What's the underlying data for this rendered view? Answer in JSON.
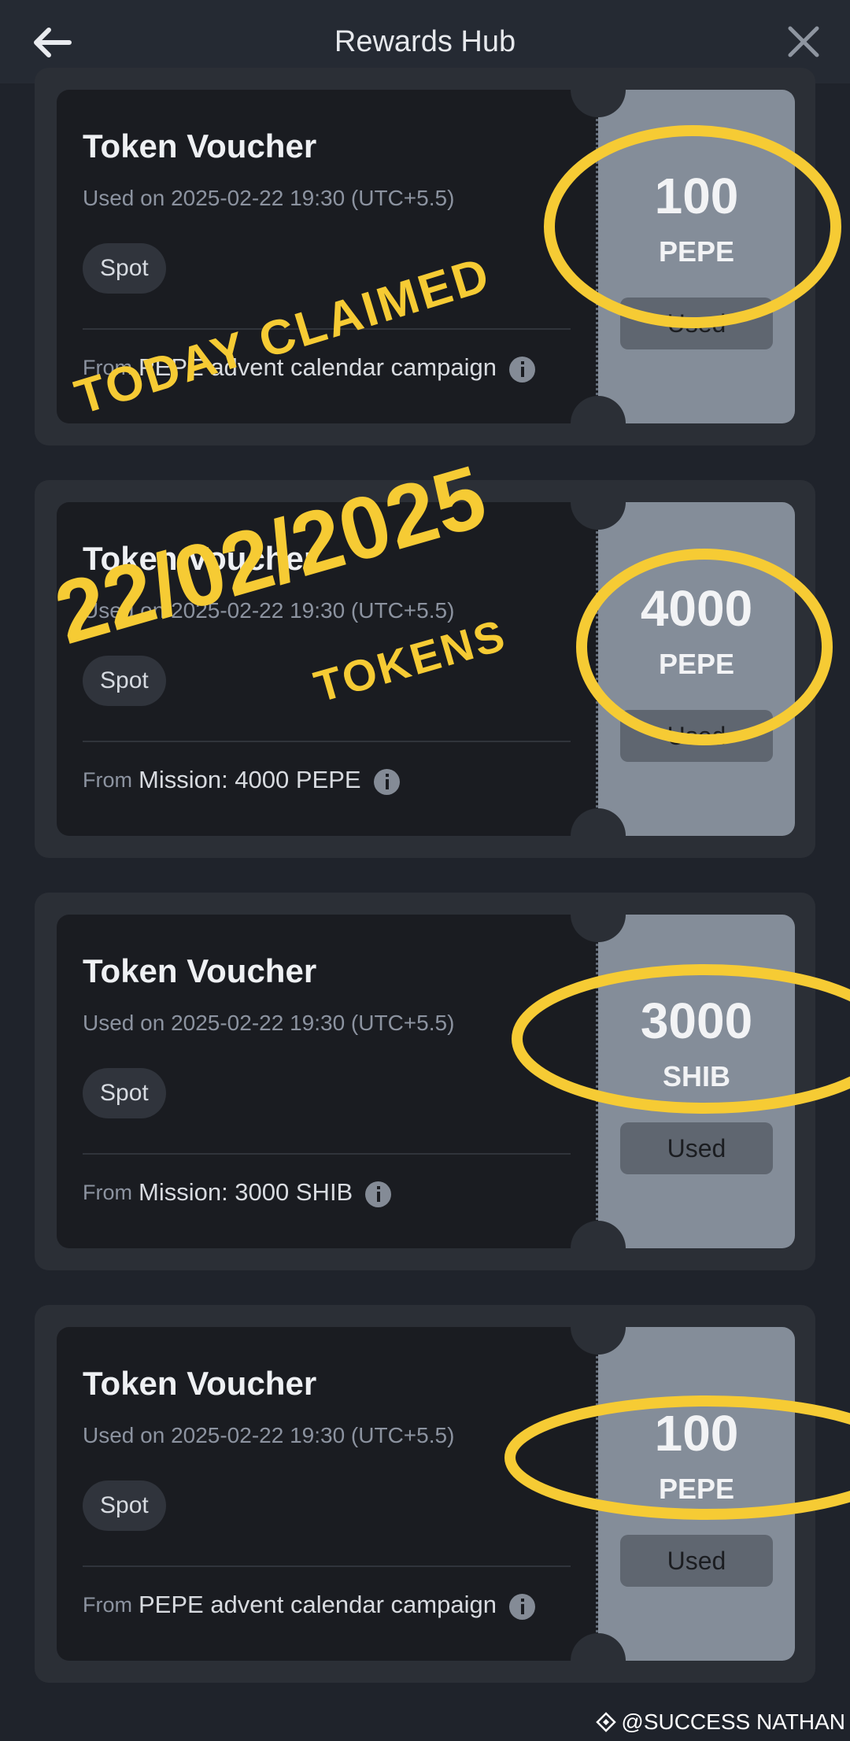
{
  "header": {
    "title": "Rewards Hub"
  },
  "vouchers": [
    {
      "title": "Token Voucher",
      "used_on": "Used on 2025-02-22 19:30 (UTC+5.5)",
      "tag": "Spot",
      "from_label": "From",
      "from_value": "PEPE advent calendar campaign",
      "amount": "100",
      "symbol": "PEPE",
      "status": "Used"
    },
    {
      "title": "Token Voucher",
      "used_on": "Used on 2025-02-22 19:30 (UTC+5.5)",
      "tag": "Spot",
      "from_label": "From",
      "from_value": "Mission: 4000 PEPE",
      "amount": "4000",
      "symbol": "PEPE",
      "status": "Used"
    },
    {
      "title": "Token Voucher",
      "used_on": "Used on 2025-02-22 19:30 (UTC+5.5)",
      "tag": "Spot",
      "from_label": "From",
      "from_value": "Mission: 3000 SHIB",
      "amount": "3000",
      "symbol": "SHIB",
      "status": "Used"
    },
    {
      "title": "Token Voucher",
      "used_on": "Used on 2025-02-22 19:30 (UTC+5.5)",
      "tag": "Spot",
      "from_label": "From",
      "from_value": "PEPE advent calendar campaign",
      "amount": "100",
      "symbol": "PEPE",
      "status": "Used"
    }
  ],
  "overlay": {
    "line1": "TODAY CLAIMED",
    "line2": "22/02/2025",
    "line3": "TOKENS",
    "color": "#f6cb34"
  },
  "watermark": {
    "text": "@SUCCESS NATHAN"
  }
}
